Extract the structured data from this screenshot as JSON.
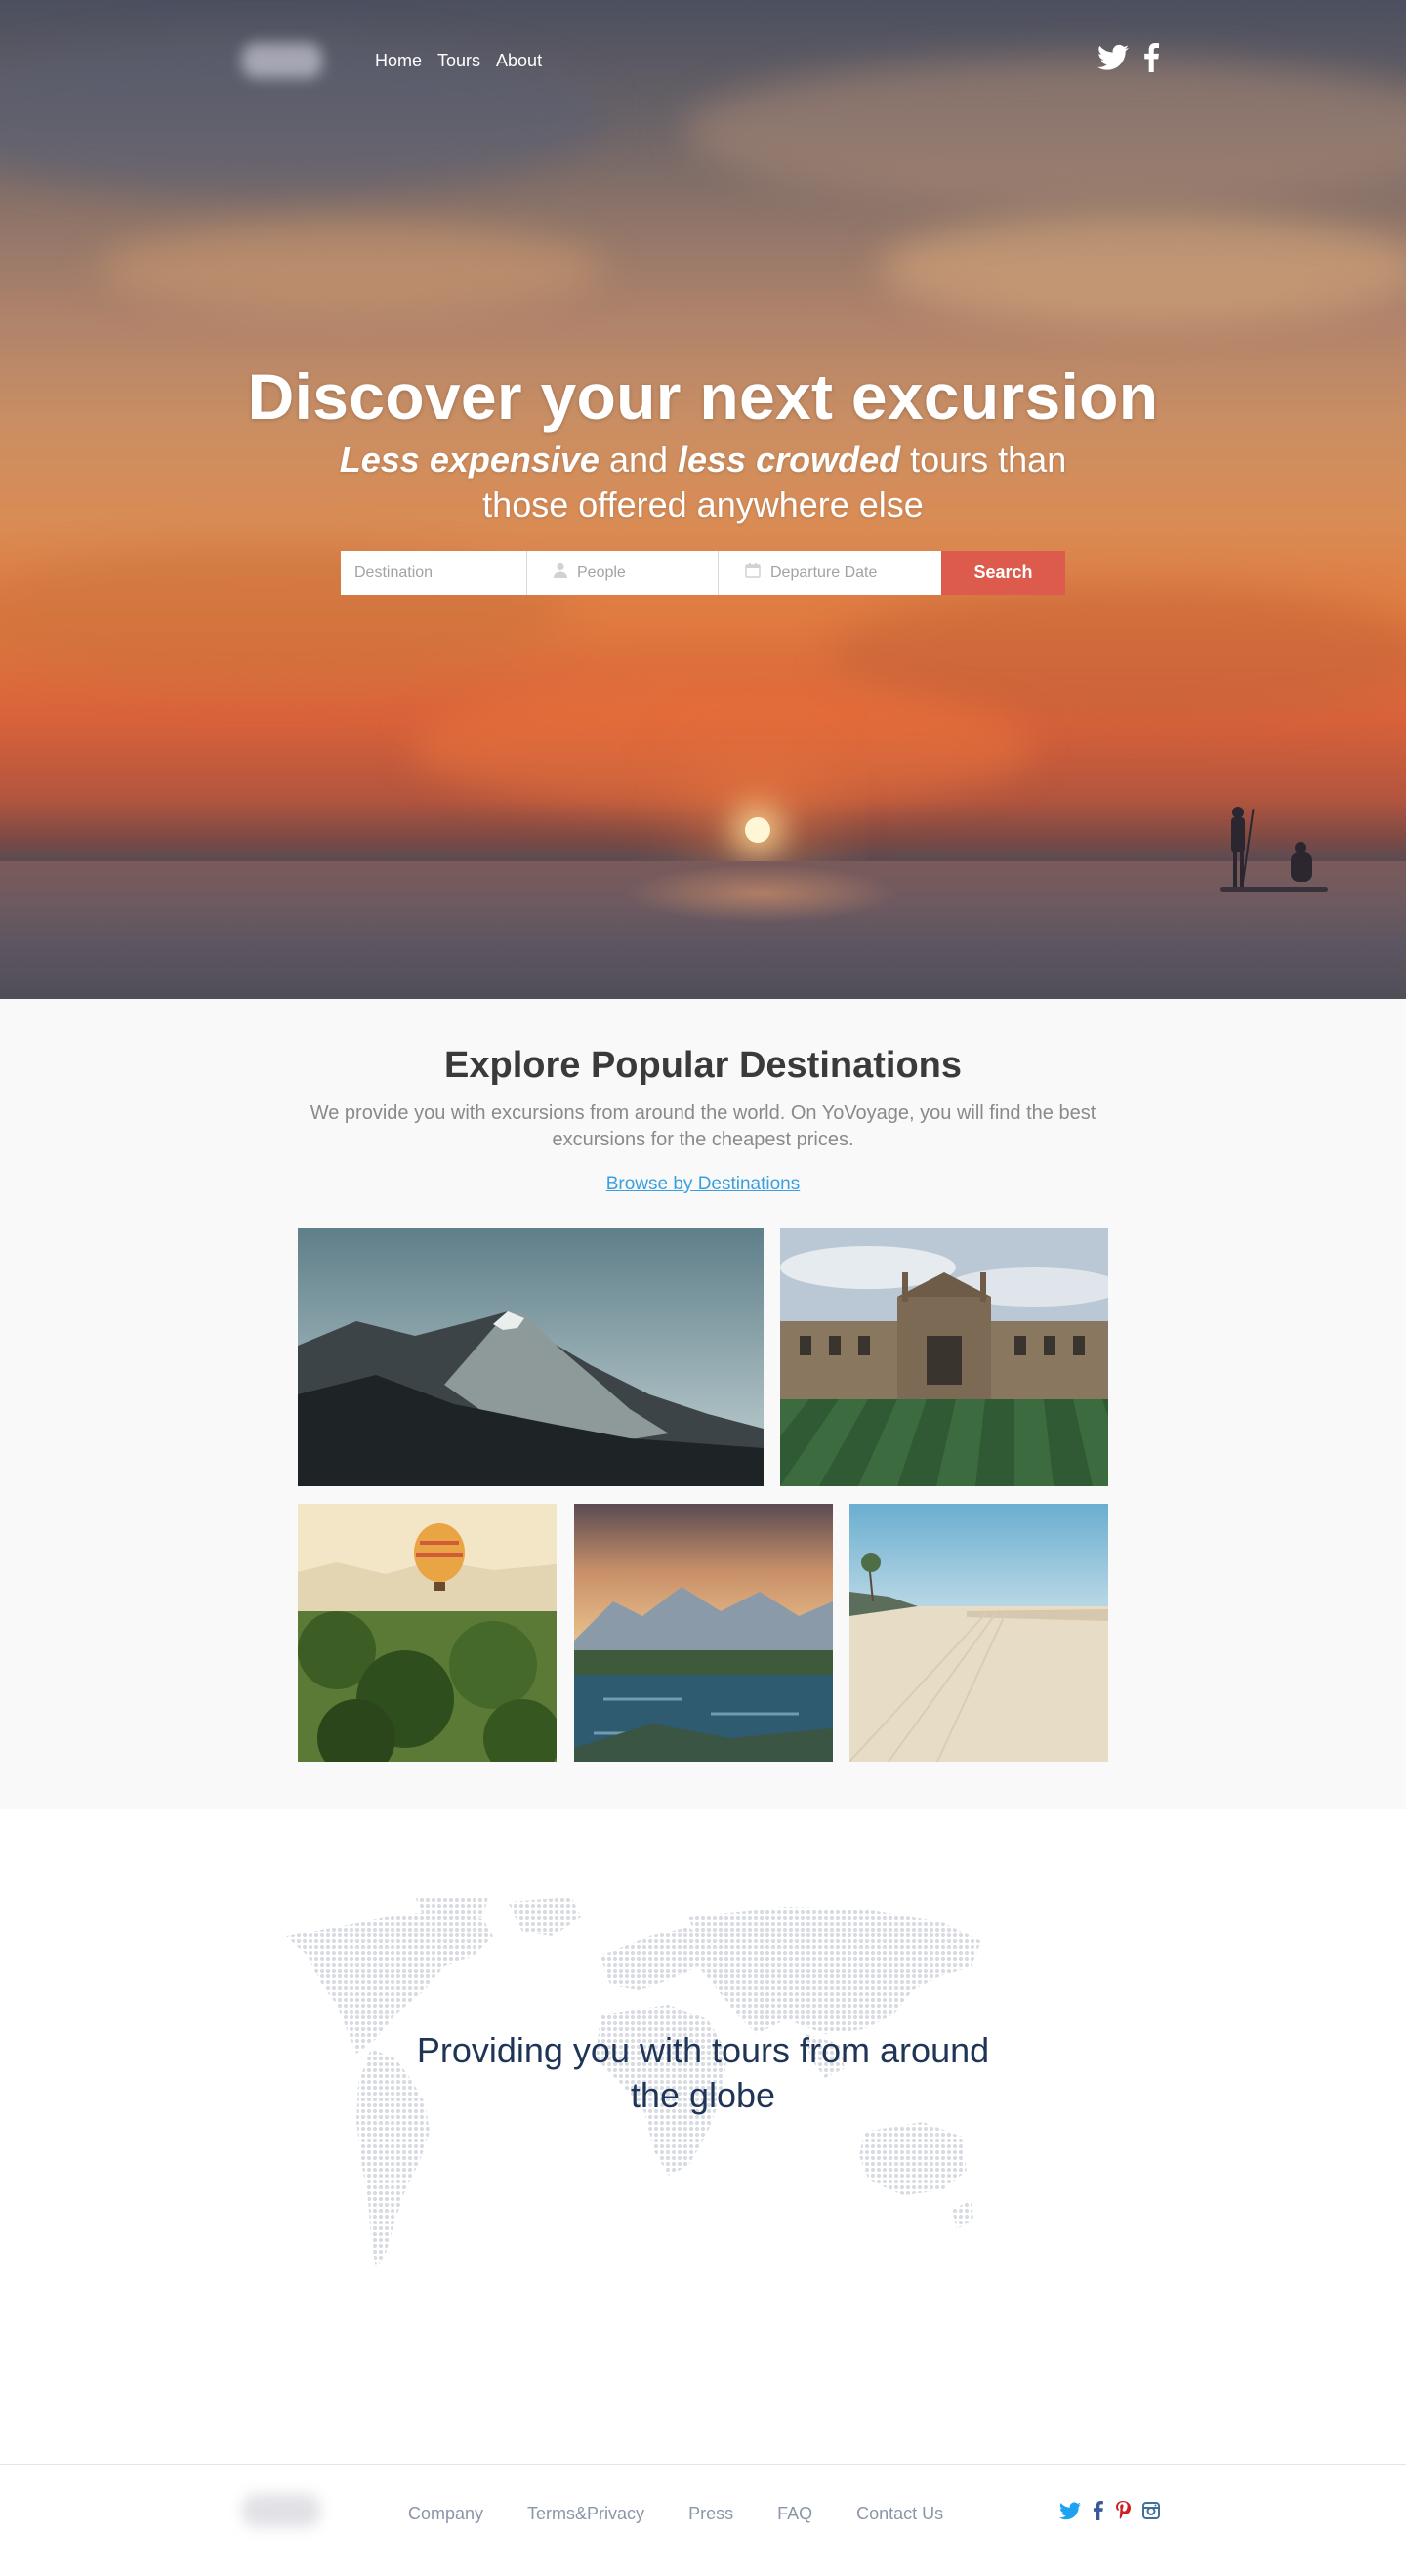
{
  "nav": {
    "links": [
      {
        "label": "Home"
      },
      {
        "label": "Tours"
      },
      {
        "label": "About"
      }
    ],
    "social": [
      "twitter-icon",
      "facebook-icon"
    ]
  },
  "hero": {
    "title": "Discover your next excursion",
    "subtitle_em1": "Less expensive",
    "subtitle_mid": " and ",
    "subtitle_em2": "less crowded",
    "subtitle_rest": " tours than those offered anywhere else",
    "search": {
      "destination_placeholder": "Destination",
      "people_placeholder": "People",
      "date_placeholder": "Departure Date",
      "button_label": "Search"
    }
  },
  "explore": {
    "title": "Explore Popular Destinations",
    "text": "We provide you with excursions from around the world. On YoVoyage, you will find the best excursions for the cheapest prices.",
    "link_label": "Browse by Destinations"
  },
  "globe": {
    "text": "Providing you with tours from around the globe"
  },
  "footer": {
    "links": [
      {
        "label": "Company"
      },
      {
        "label": "Terms&Privacy"
      },
      {
        "label": "Press"
      },
      {
        "label": "FAQ"
      },
      {
        "label": "Contact Us"
      }
    ],
    "social": [
      "twitter-icon",
      "facebook-icon",
      "pinterest-icon",
      "instagram-icon"
    ]
  },
  "colors": {
    "accent": "#dc5b4c",
    "link": "#3aa0dd",
    "twitter": "#1da1f2",
    "facebook": "#3b5998",
    "pinterest": "#cb2027",
    "instagram": "#3f729b"
  }
}
